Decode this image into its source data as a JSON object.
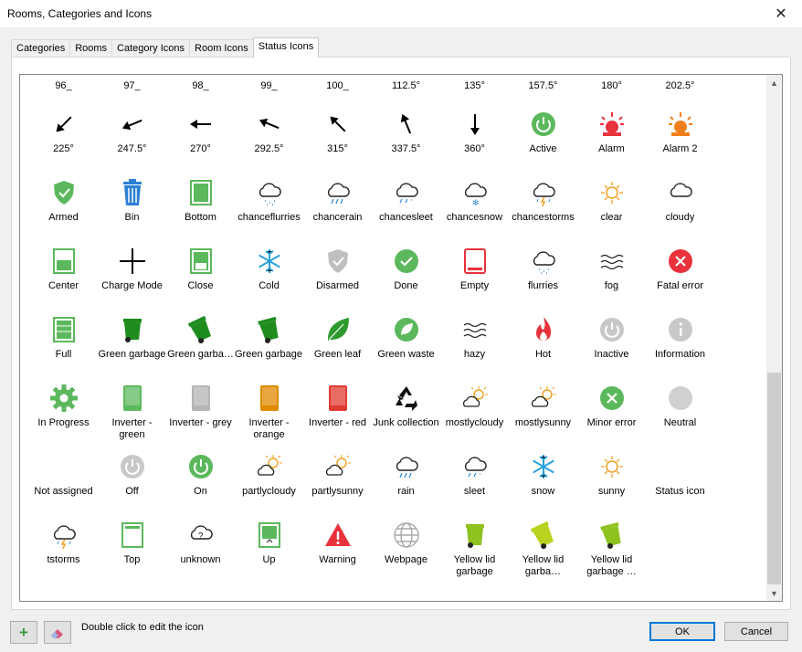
{
  "window": {
    "title": "Rooms, Categories and Icons",
    "close_glyph": "✕"
  },
  "tabs": [
    {
      "label": "Categories"
    },
    {
      "label": "Rooms"
    },
    {
      "label": "Category Icons"
    },
    {
      "label": "Room Icons"
    },
    {
      "label": "Status Icons",
      "active": true
    }
  ],
  "top_row": [
    "96_",
    "97_",
    "98_",
    "99_",
    "100_",
    "112.5°",
    "135°",
    "157.5°",
    "180°",
    "202.5°"
  ],
  "icons": [
    {
      "label": "225°",
      "icon": "arrow-225-icon"
    },
    {
      "label": "247.5°",
      "icon": "arrow-247-icon"
    },
    {
      "label": "270°",
      "icon": "arrow-270-icon"
    },
    {
      "label": "292.5°",
      "icon": "arrow-292-icon"
    },
    {
      "label": "315°",
      "icon": "arrow-315-icon"
    },
    {
      "label": "337.5°",
      "icon": "arrow-337-icon"
    },
    {
      "label": "360°",
      "icon": "arrow-360-icon"
    },
    {
      "label": "Active",
      "icon": "power-green-icon"
    },
    {
      "label": "Alarm",
      "icon": "siren-red-icon"
    },
    {
      "label": "Alarm 2",
      "icon": "siren-orange-icon"
    },
    {
      "label": "Armed",
      "icon": "shield-green-icon"
    },
    {
      "label": "Bin",
      "icon": "bin-blue-icon"
    },
    {
      "label": "Bottom",
      "icon": "bottom-green-icon"
    },
    {
      "label": "chanceflurries",
      "icon": "cloud-flurries-icon"
    },
    {
      "label": "chancerain",
      "icon": "cloud-rain-icon"
    },
    {
      "label": "chancesleet",
      "icon": "cloud-sleet-icon"
    },
    {
      "label": "chancesnow",
      "icon": "cloud-snow-icon"
    },
    {
      "label": "chancestorms",
      "icon": "cloud-storm-icon"
    },
    {
      "label": "clear",
      "icon": "sun-icon"
    },
    {
      "label": "cloudy",
      "icon": "cloud-icon"
    },
    {
      "label": "Center",
      "icon": "center-green-icon"
    },
    {
      "label": "Charge Mode",
      "icon": "plus-black-icon"
    },
    {
      "label": "Close",
      "icon": "close-green-icon"
    },
    {
      "label": "Cold",
      "icon": "snowflake-blue-icon"
    },
    {
      "label": "Disarmed",
      "icon": "shield-grey-icon"
    },
    {
      "label": "Done",
      "icon": "check-green-icon"
    },
    {
      "label": "Empty",
      "icon": "empty-red-icon"
    },
    {
      "label": "flurries",
      "icon": "cloud-flurries-icon"
    },
    {
      "label": "fog",
      "icon": "fog-icon"
    },
    {
      "label": "Fatal error",
      "icon": "x-red-icon"
    },
    {
      "label": "Full",
      "icon": "full-green-icon"
    },
    {
      "label": "Green garbage",
      "icon": "garbage-green-icon"
    },
    {
      "label": "Green garba…",
      "icon": "garbage-green-tilt-icon"
    },
    {
      "label": "Green garbage …",
      "icon": "garbage-green-tilt2-icon"
    },
    {
      "label": "Green leaf",
      "icon": "leaf-icon"
    },
    {
      "label": "Green waste",
      "icon": "green-waste-icon"
    },
    {
      "label": "hazy",
      "icon": "haze-icon"
    },
    {
      "label": "Hot",
      "icon": "flame-icon"
    },
    {
      "label": "Inactive",
      "icon": "power-grey-icon"
    },
    {
      "label": "Information",
      "icon": "info-grey-icon"
    },
    {
      "label": "In Progress",
      "icon": "gear-green-icon"
    },
    {
      "label": "Inverter - green",
      "icon": "inverter-green-icon"
    },
    {
      "label": "Inverter - grey",
      "icon": "inverter-grey-icon"
    },
    {
      "label": "Inverter - orange",
      "icon": "inverter-orange-icon"
    },
    {
      "label": "Inverter - red",
      "icon": "inverter-red-icon"
    },
    {
      "label": "Junk collection",
      "icon": "recycle-icon"
    },
    {
      "label": "mostlycloudy",
      "icon": "sun-cloud-icon"
    },
    {
      "label": "mostlysunny",
      "icon": "sun-cloud2-icon"
    },
    {
      "label": "Minor error",
      "icon": "x-green-icon"
    },
    {
      "label": "Neutral",
      "icon": "circle-grey-icon"
    },
    {
      "label": "Not assigned",
      "icon": "none-icon"
    },
    {
      "label": "Off",
      "icon": "power-grey-icon"
    },
    {
      "label": "On",
      "icon": "power-green-icon"
    },
    {
      "label": "partlycloudy",
      "icon": "sun-cloud2-icon"
    },
    {
      "label": "partlysunny",
      "icon": "sun-cloud-icon"
    },
    {
      "label": "rain",
      "icon": "cloud-rain-icon"
    },
    {
      "label": "sleet",
      "icon": "cloud-sleet-icon"
    },
    {
      "label": "snow",
      "icon": "snowflake-blue-icon"
    },
    {
      "label": "sunny",
      "icon": "sun-icon"
    },
    {
      "label": "Status icon",
      "icon": "none-icon"
    },
    {
      "label": "tstorms",
      "icon": "cloud-storm-icon"
    },
    {
      "label": "Top",
      "icon": "top-green-icon"
    },
    {
      "label": "unknown",
      "icon": "cloud-question-icon"
    },
    {
      "label": "Up",
      "icon": "up-green-icon"
    },
    {
      "label": "Warning",
      "icon": "warning-red-icon"
    },
    {
      "label": "Webpage",
      "icon": "globe-icon"
    },
    {
      "label": "Yellow lid garbage",
      "icon": "garbage-yellow-icon"
    },
    {
      "label": "Yellow lid garba…",
      "icon": "garbage-yellow-tilt-icon"
    },
    {
      "label": "Yellow lid garbage …",
      "icon": "garbage-yellow-tilt2-icon"
    }
  ],
  "footer": {
    "add_glyph": "+",
    "hint": "Double click to edit the icon",
    "ok": "OK",
    "cancel": "Cancel"
  },
  "colors": {
    "green": "#5cb85c",
    "red": "#e8323c",
    "orange": "#f0801e",
    "blue": "#2a7fd4",
    "grey": "#c8c8c8"
  }
}
